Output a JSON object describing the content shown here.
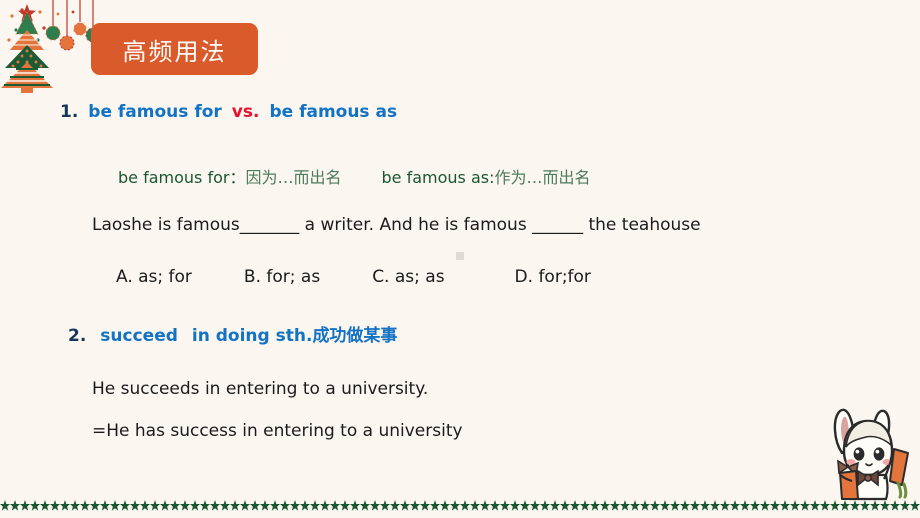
{
  "slide": {
    "background_color": "#FBF6F0",
    "accent_orange": "#D95A2B",
    "accent_blue": "#1272C4",
    "accent_red": "#E8112D",
    "accent_green": "#1A5632",
    "text_dark": "#1B1B1B"
  },
  "title_badge": {
    "label": "高频用法"
  },
  "items": [
    {
      "number": "1.",
      "phrase_a": "be famous for",
      "separator": "vs.",
      "phrase_b": "be famous as"
    },
    {
      "number": "2.",
      "term": "succeed",
      "phrase": "in doing sth.",
      "gloss": "成功做某事"
    }
  ],
  "definitions": {
    "def_a_term": "be famous for：",
    "def_a_gloss": "因为…而出名",
    "def_b_term": "be famous as:",
    "def_b_gloss": "作为…而出名"
  },
  "question": {
    "sentence": "Laoshe is famous_______ a writer. And he is famous ______ the teahouse",
    "options": [
      "A. as; for",
      "B. for; as",
      "C. as; as",
      "D. for;for"
    ]
  },
  "examples": [
    "He succeeds in entering to a university.",
    "=He has success in entering to a university"
  ],
  "decor": {
    "christmas_tree": "christmas-tree-icon",
    "ornaments": "hanging-ornaments-icon",
    "mascot": "bunny-mascot-icon",
    "star_border": "star-border-icon",
    "star_count": 92
  }
}
